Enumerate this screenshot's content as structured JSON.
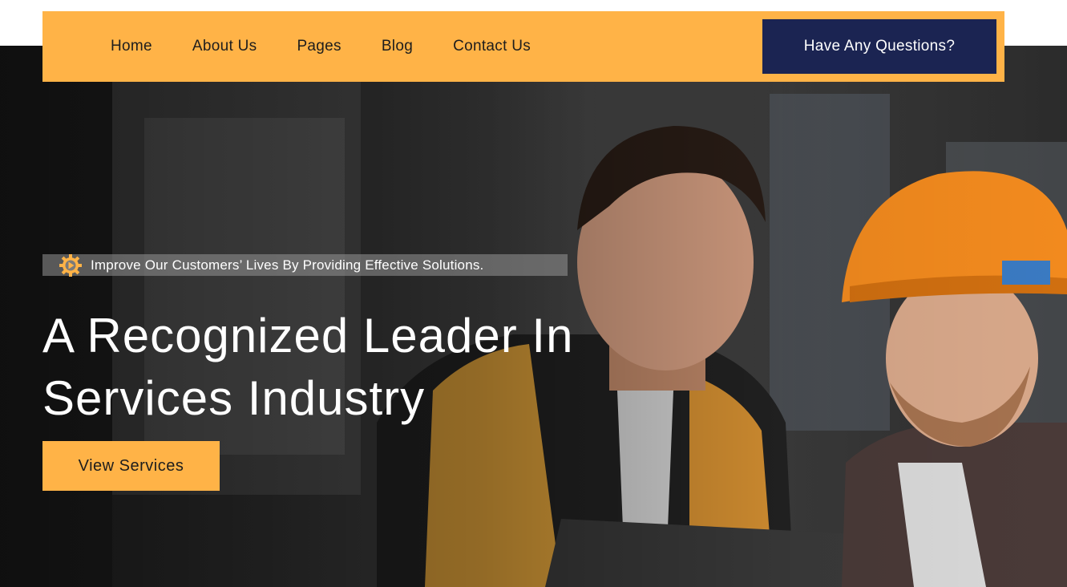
{
  "nav": {
    "items": [
      {
        "label": "Home"
      },
      {
        "label": "About Us"
      },
      {
        "label": "Pages"
      },
      {
        "label": "Blog"
      },
      {
        "label": "Contact Us"
      }
    ],
    "cta_label": "Have Any Questions?"
  },
  "hero": {
    "tagline": "Improve Our Customers’ Lives By Providing Effective Solutions.",
    "tagline_icon": "gear-icon",
    "headline_line1": "A Recognized Leader In",
    "headline_line2": "Services Industry",
    "button_label": "View Services"
  },
  "colors": {
    "accent": "#ffb347",
    "navy": "#1b2452",
    "text_light": "#ffffff",
    "text_dark": "#1d1d1d"
  }
}
